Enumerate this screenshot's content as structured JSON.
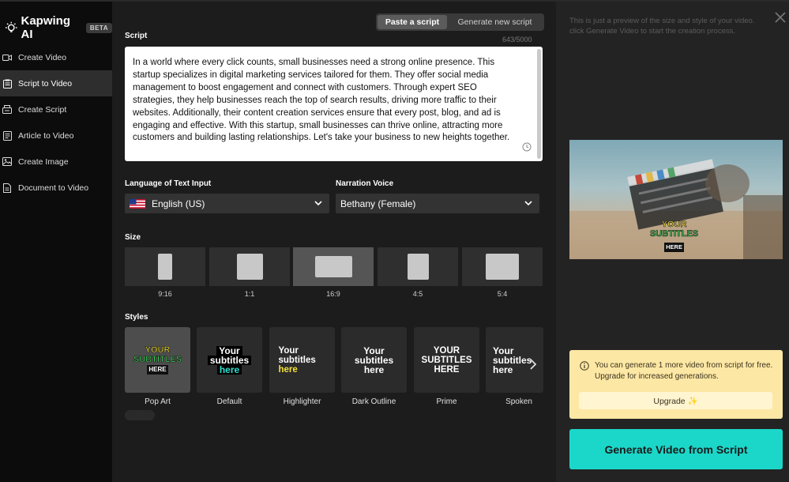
{
  "brand": {
    "name": "Kapwing AI",
    "badge": "BETA"
  },
  "sidebar": {
    "items": [
      {
        "label": "Create Video",
        "icon": "video-camera-icon",
        "active": false
      },
      {
        "label": "Script to Video",
        "icon": "clipboard-icon",
        "active": true
      },
      {
        "label": "Create Script",
        "icon": "script-icon",
        "active": false
      },
      {
        "label": "Article to Video",
        "icon": "article-icon",
        "active": false
      },
      {
        "label": "Create Image",
        "icon": "image-icon",
        "active": false
      },
      {
        "label": "Document to Video",
        "icon": "document-icon",
        "active": false
      }
    ]
  },
  "main": {
    "mode_tabs": [
      {
        "label": "Paste a script",
        "active": true
      },
      {
        "label": "Generate new script",
        "active": false
      }
    ],
    "script_label": "Script",
    "char_count": "643/5000",
    "script_text": "In a world where every click counts, small businesses need a strong online presence. This startup specializes in digital marketing services tailored for them. They offer social media management to boost engagement and connect with customers. Through expert SEO strategies, they help businesses reach the top of search results, driving more traffic to their websites. Additionally, their content creation services ensure that every post, blog, and ad is engaging and effective. With this startup, small businesses can thrive online, attracting more customers and building lasting relationships. Let's take your business to new heights together.",
    "language_label": "Language of Text Input",
    "language_value": "English (US)",
    "voice_label": "Narration Voice",
    "voice_value": "Bethany (Female)",
    "size_label": "Size",
    "sizes": [
      {
        "label": "9:16",
        "active": false
      },
      {
        "label": "1:1",
        "active": false
      },
      {
        "label": "16:9",
        "active": true
      },
      {
        "label": "4:5",
        "active": false
      },
      {
        "label": "5:4",
        "active": false
      }
    ],
    "styles_label": "Styles",
    "styles": [
      {
        "label": "Pop Art",
        "preview": [
          "YOUR",
          "SUBTITLES",
          "HERE"
        ],
        "active": true
      },
      {
        "label": "Default",
        "preview": [
          "Your",
          "subtitles",
          "here"
        ],
        "active": false
      },
      {
        "label": "Highlighter",
        "preview": [
          "Your",
          "subtitles",
          "here"
        ],
        "active": false
      },
      {
        "label": "Dark Outline",
        "preview": [
          "Your",
          "subtitles",
          "here"
        ],
        "active": false
      },
      {
        "label": "Prime",
        "preview": [
          "YOUR",
          "SUBTITLES",
          "HERE"
        ],
        "active": false
      },
      {
        "label": "Spoken",
        "preview": [
          "Your",
          "subtitles",
          "here"
        ],
        "active": false
      }
    ]
  },
  "right": {
    "preview_note": "This is just a preview of the size and style of your video. click Generate Video to start the creation process.",
    "preview_subtitle": [
      "YOUR",
      "SUBTITLES",
      "HERE"
    ],
    "upgrade_notice": "You can generate 1 more video from script for free. Upgrade for increased generations.",
    "upgrade_button": "Upgrade ✨",
    "generate_button": "Generate Video from Script"
  },
  "colors": {
    "accent": "#1bd7c9",
    "notice_bg": "#fde7a4",
    "popart_yellow": "#f5e33b",
    "popart_green": "#43d35a",
    "default_cyan": "#2fe0d2"
  }
}
